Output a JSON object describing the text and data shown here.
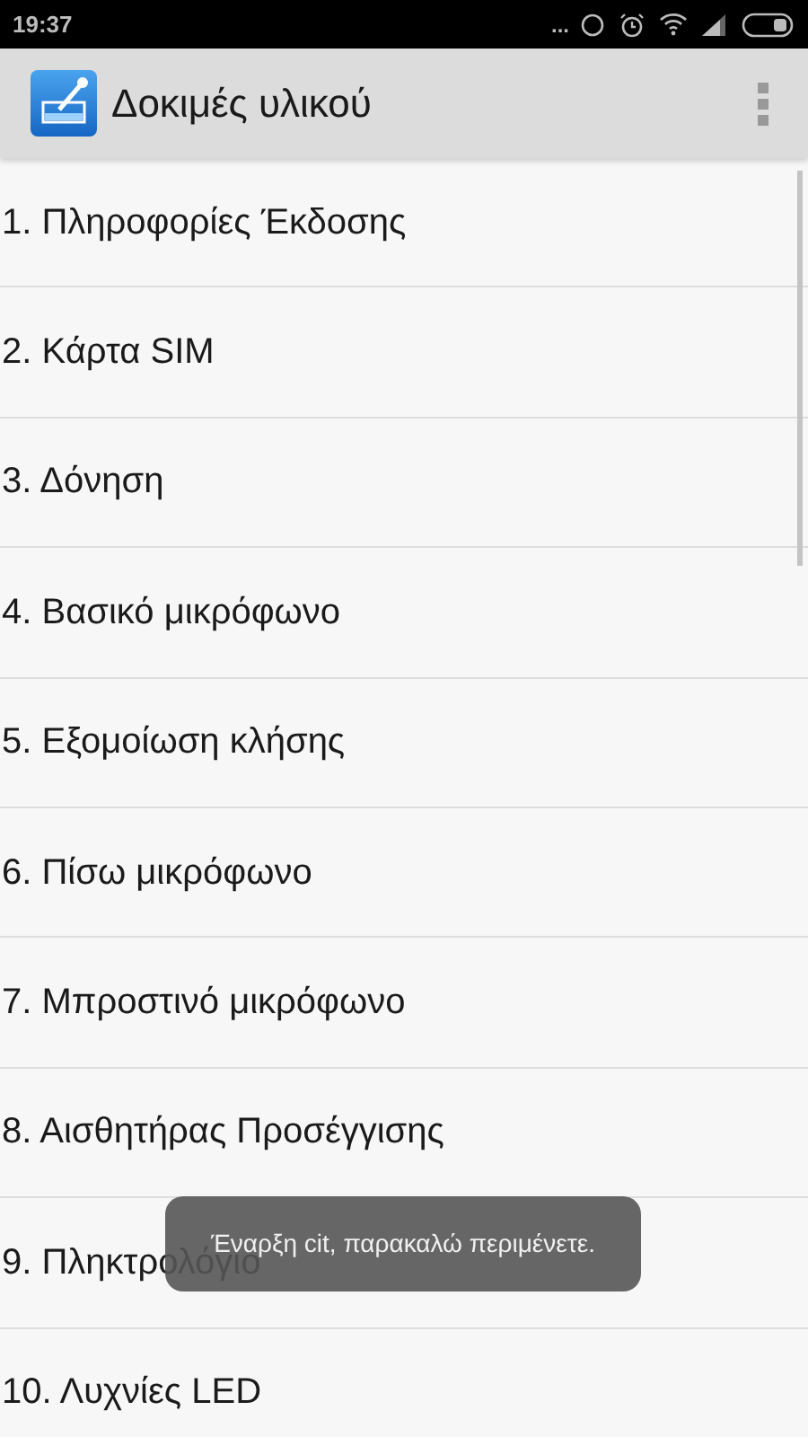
{
  "status_bar": {
    "time": "19:37",
    "overflow": "..."
  },
  "app_bar": {
    "title": "Δοκιμές υλικού"
  },
  "items": [
    {
      "label": "1. Πληροφορίες Έκδοσης"
    },
    {
      "label": "2. Κάρτα SIM"
    },
    {
      "label": "3. Δόνηση"
    },
    {
      "label": "4. Βασικό μικρόφωνο"
    },
    {
      "label": "5. Εξομοίωση κλήσης"
    },
    {
      "label": "6. Πίσω μικρόφωνο"
    },
    {
      "label": "7. Μπροστινό μικρόφωνο"
    },
    {
      "label": "8. Αισθητήρας Προσέγγισης"
    },
    {
      "label": "9. Πληκτρολόγιο"
    },
    {
      "label": "10. Λυχνίες LED"
    }
  ],
  "toast": "Έναρξη cit, παρακαλώ περιμένετε."
}
